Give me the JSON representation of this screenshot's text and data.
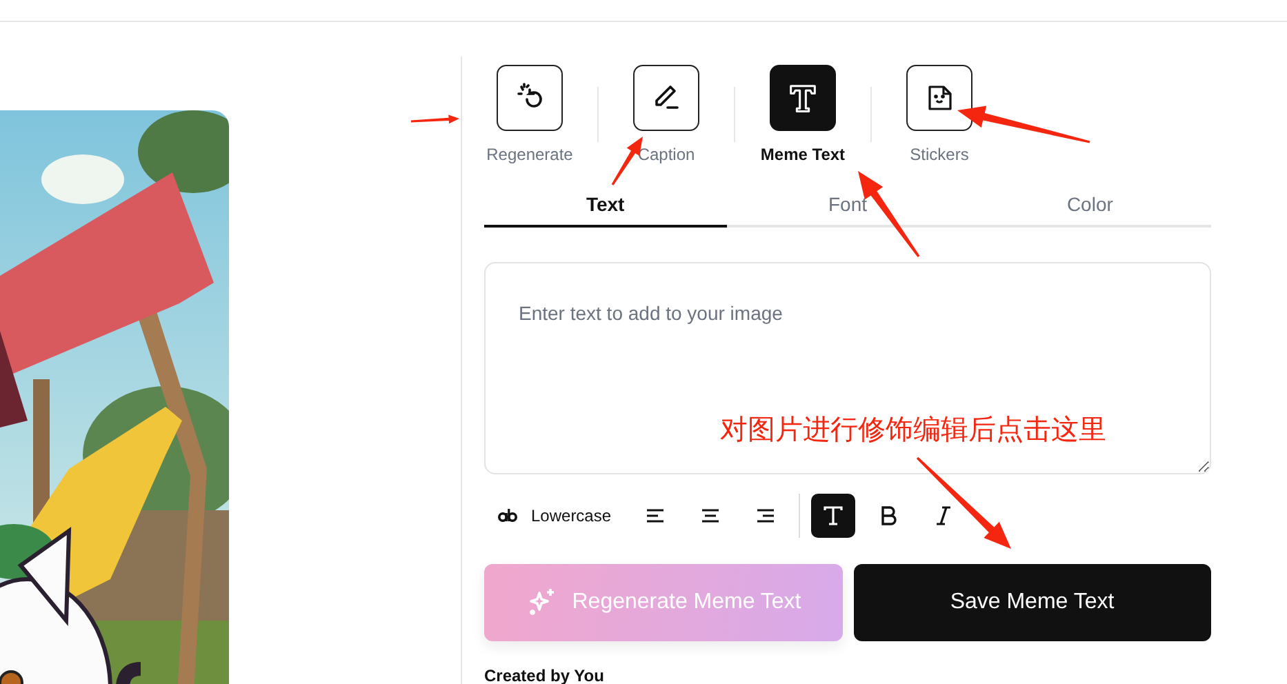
{
  "tools": [
    {
      "label": "Regenerate",
      "kind": "regenerate",
      "selected": false
    },
    {
      "label": "Caption",
      "kind": "caption",
      "selected": false
    },
    {
      "label": "Meme Text",
      "kind": "meme-text",
      "selected": true
    },
    {
      "label": "Stickers",
      "kind": "stickers",
      "selected": false
    }
  ],
  "tabs": [
    {
      "label": "Text",
      "selected": true
    },
    {
      "label": "Font",
      "selected": false
    },
    {
      "label": "Color",
      "selected": false
    }
  ],
  "text_input": {
    "placeholder": "Enter text to add to your image"
  },
  "format_toolbar": {
    "case_button": {
      "label": "Lowercase"
    },
    "items": [
      {
        "kind": "align-left",
        "selected": false
      },
      {
        "kind": "align-center",
        "selected": false
      },
      {
        "kind": "align-right",
        "selected": false
      },
      {
        "kind": "font-style",
        "selected": true
      },
      {
        "kind": "bold",
        "selected": false
      },
      {
        "kind": "italic",
        "selected": false
      }
    ]
  },
  "buttons": [
    {
      "label": "Regenerate Meme Text",
      "kind": "gradient"
    },
    {
      "label": "Save Meme Text",
      "kind": "primary"
    }
  ],
  "footer": {
    "text": "Created by You"
  },
  "annotation": {
    "note": "对图片进行修饰编辑后点击这里"
  }
}
